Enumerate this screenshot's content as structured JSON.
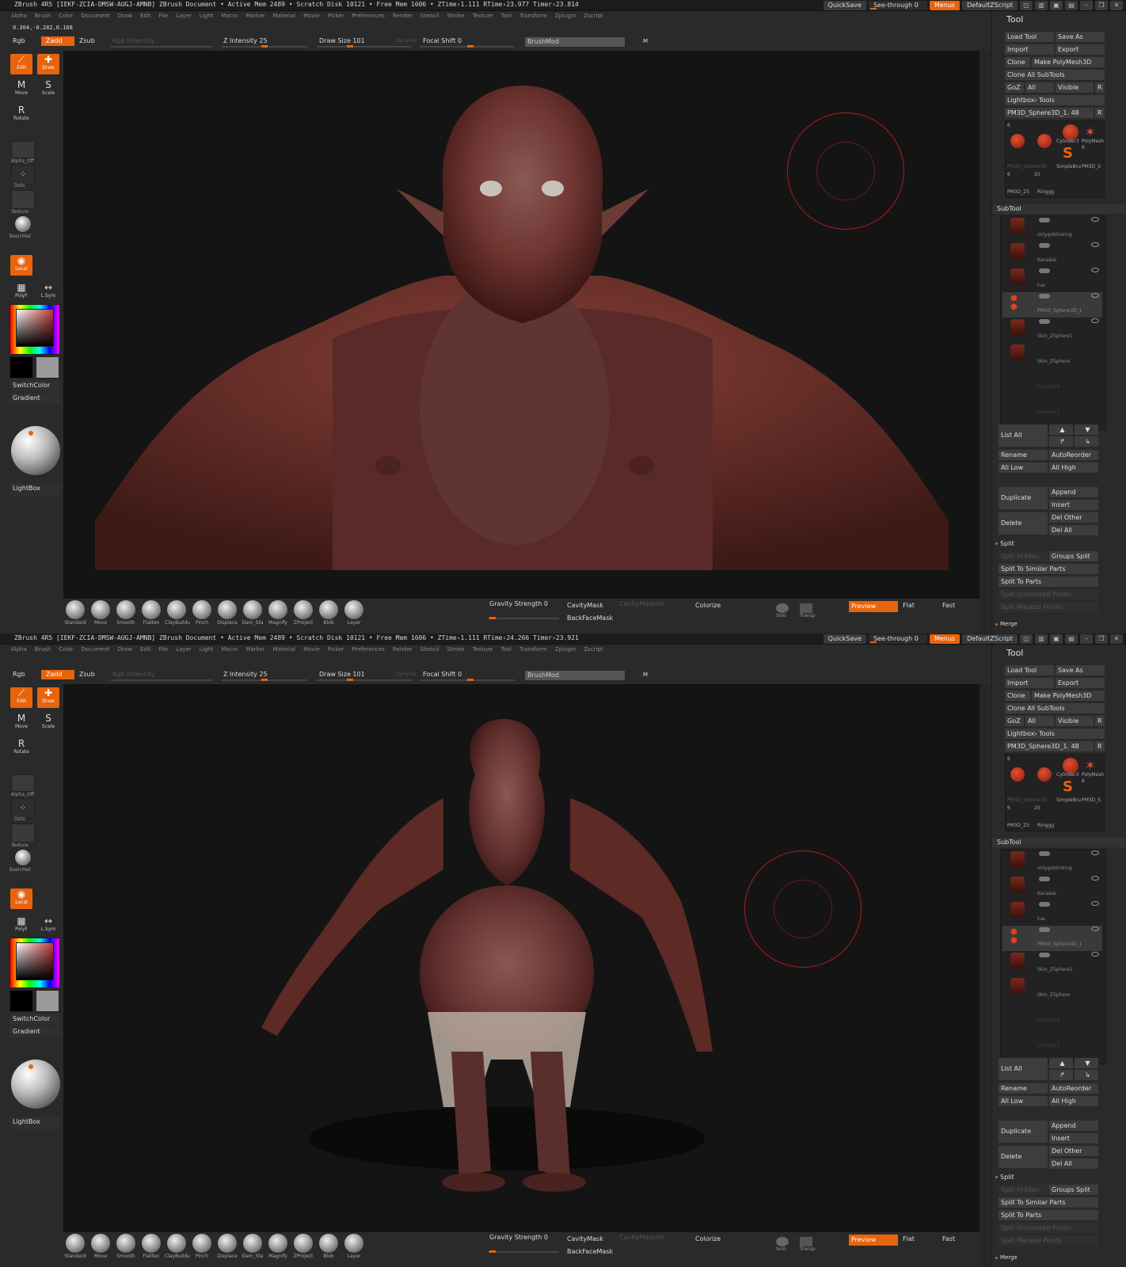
{
  "titlebar": {
    "screen1": "ZBrush 4R5 [IEKF-ZCIA-DMSW-AUGJ-AMNB]   ZBrush Document   • Active Mem 2489 • Scratch Disk 10121 • Free Mem 1606 • ZTime›1.111 RTime›23.977 Timer›23.814",
    "screen2": "ZBrush 4R5 [IEKF-ZCIA-DMSW-AUGJ-AMNB]   ZBrush Document   • Active Mem 2489 • Scratch Disk 10121 • Free Mem 1606 • ZTime›1.111 RTime›24.266 Timer›23.921",
    "quicksave": "QuickSave",
    "see_through": "See-through  0",
    "menus": "Menus",
    "script": "DefaultZScript"
  },
  "menus": [
    "Alpha",
    "Brush",
    "Color",
    "Document",
    "Draw",
    "Edit",
    "File",
    "Layer",
    "Light",
    "Macro",
    "Marker",
    "Material",
    "Movie",
    "Picker",
    "Preferences",
    "Render",
    "Stencil",
    "Stroke",
    "Texture",
    "Tool",
    "Transform",
    "Zplugin",
    "Zscript"
  ],
  "coords": "0.304,-0.282,0.168",
  "top_shelf": {
    "rgb": "Rgb",
    "zadd": "Zadd",
    "zsub": "Zsub",
    "rgb_intensity": "Rgb Intensity",
    "z_intensity": "Z Intensity 25",
    "draw_size": "Draw Size 101",
    "dynamic": "Dynamic",
    "focal_shift": "Focal Shift 0",
    "brushmod": "BrushMod",
    "m": "M"
  },
  "left_bar": {
    "edit": "Edit",
    "draw": "Draw",
    "move": "Move",
    "scale": "Scale",
    "rotate": "Rotate",
    "alpha": "Alpha_Off",
    "dots": "Dots",
    "texture": "Texture",
    "material": "BasicMat",
    "local": "Local",
    "polyf": "PolyF",
    "lsym": "L.Sym",
    "switch_color": "SwitchColor",
    "gradient": "Gradient",
    "lightbox": "LightBox"
  },
  "bottom_bar": {
    "brushes": [
      "Standard",
      "Move",
      "Smooth",
      "Flatten",
      "ClayBuildu",
      "Pinch",
      "Displace",
      "Dam_Sta",
      "Magnify",
      "ZProject",
      "Blob",
      "Layer"
    ],
    "gravity": "Gravity Strength 0",
    "cavity": "CavityMask",
    "cavity_int": "CavityMaskInt",
    "backface": "BackFaceMask",
    "colorize": "Colorize",
    "solo": "Solo",
    "transp": "Transp",
    "preview": "Preview",
    "flat": "Flat",
    "fast": "Fast"
  },
  "tool_panel": {
    "title": "Tool",
    "load_tool": "Load Tool",
    "save_as": "Save As",
    "import": "Import",
    "export": "Export",
    "clone": "Clone",
    "make_polymesh": "Make PolyMesh3D",
    "clone_all": "Clone All SubTools",
    "goz": "GoZ",
    "all": "All",
    "visible": "Visible",
    "r": "R",
    "lightbox_tools": "Lightbox› Tools",
    "current_tool": "PM3D_Sphere3D_1. 48",
    "thumbs": [
      "PM3D_Sphere3D",
      "Cylinder3",
      "PolyMesh",
      "SimpleBru",
      "PM3D_S",
      "PM3D_Z5",
      "Ringgg"
    ],
    "thumb_counts": [
      "6",
      "6",
      "6",
      "20"
    ],
    "subtool_title": "SubTool",
    "subtools": [
      "onlygoblinking",
      "Karadas",
      "tue",
      "PM3D_Sphere3D_1",
      "Skin_ZSphere1",
      "Skin_ZSphere",
      "Unused 6",
      "Unused 7"
    ],
    "list_all": "List All",
    "rename": "Rename",
    "autoreorder": "AutoReorder",
    "all_low": "All Low",
    "all_high": "All High",
    "duplicate": "Duplicate",
    "append": "Append",
    "insert": "Insert",
    "delete": "Delete",
    "del_other": "Del Other",
    "del_all": "Del All",
    "split": "Split",
    "split_hidden": "Split Hidden",
    "groups_split": "Groups Split",
    "split_similar": "Split To Similar Parts",
    "split_parts": "Split To Parts",
    "split_unmasked": "Split Unmasked Points",
    "split_masked": "Split Masked Points",
    "merge": "Merge"
  },
  "colors": {
    "accent": "#e8640c",
    "circle": "#b31b1b",
    "bg": "#2a2a2a",
    "canvas": "#141414"
  }
}
